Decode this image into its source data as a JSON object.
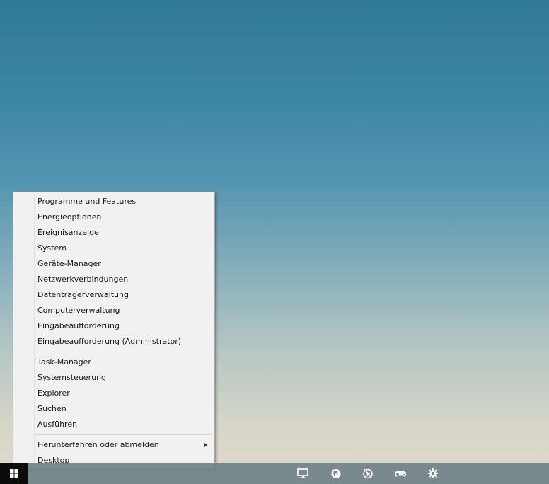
{
  "context_menu": {
    "group1": [
      {
        "label": "Programme und Features"
      },
      {
        "label": "Energieoptionen"
      },
      {
        "label": "Ereignisanzeige"
      },
      {
        "label": "System"
      },
      {
        "label": "Geräte-Manager"
      },
      {
        "label": "Netzwerkverbindungen"
      },
      {
        "label": "Datenträgerverwaltung"
      },
      {
        "label": "Computerverwaltung"
      },
      {
        "label": "Eingabeaufforderung"
      },
      {
        "label": "Eingabeaufforderung (Administrator)"
      }
    ],
    "group2": [
      {
        "label": "Task-Manager"
      },
      {
        "label": "Systemsteuerung"
      },
      {
        "label": "Explorer"
      },
      {
        "label": "Suchen"
      },
      {
        "label": "Ausführen"
      }
    ],
    "group3": [
      {
        "label": "Herunterfahren oder abmelden",
        "has_submenu": true
      },
      {
        "label": "Desktop"
      }
    ]
  },
  "taskbar": {
    "start_icon": "windows-logo-icon",
    "pinned": [
      {
        "icon": "monitor-icon"
      },
      {
        "icon": "firefox-icon"
      },
      {
        "icon": "media-player-icon"
      },
      {
        "icon": "gamepad-icon"
      },
      {
        "icon": "gear-icon"
      }
    ]
  },
  "colors": {
    "menu_background": "#f1f1f1",
    "menu_border": "#a9a9a9",
    "taskbar": "#708288",
    "start_button": "#0b0b0b"
  }
}
